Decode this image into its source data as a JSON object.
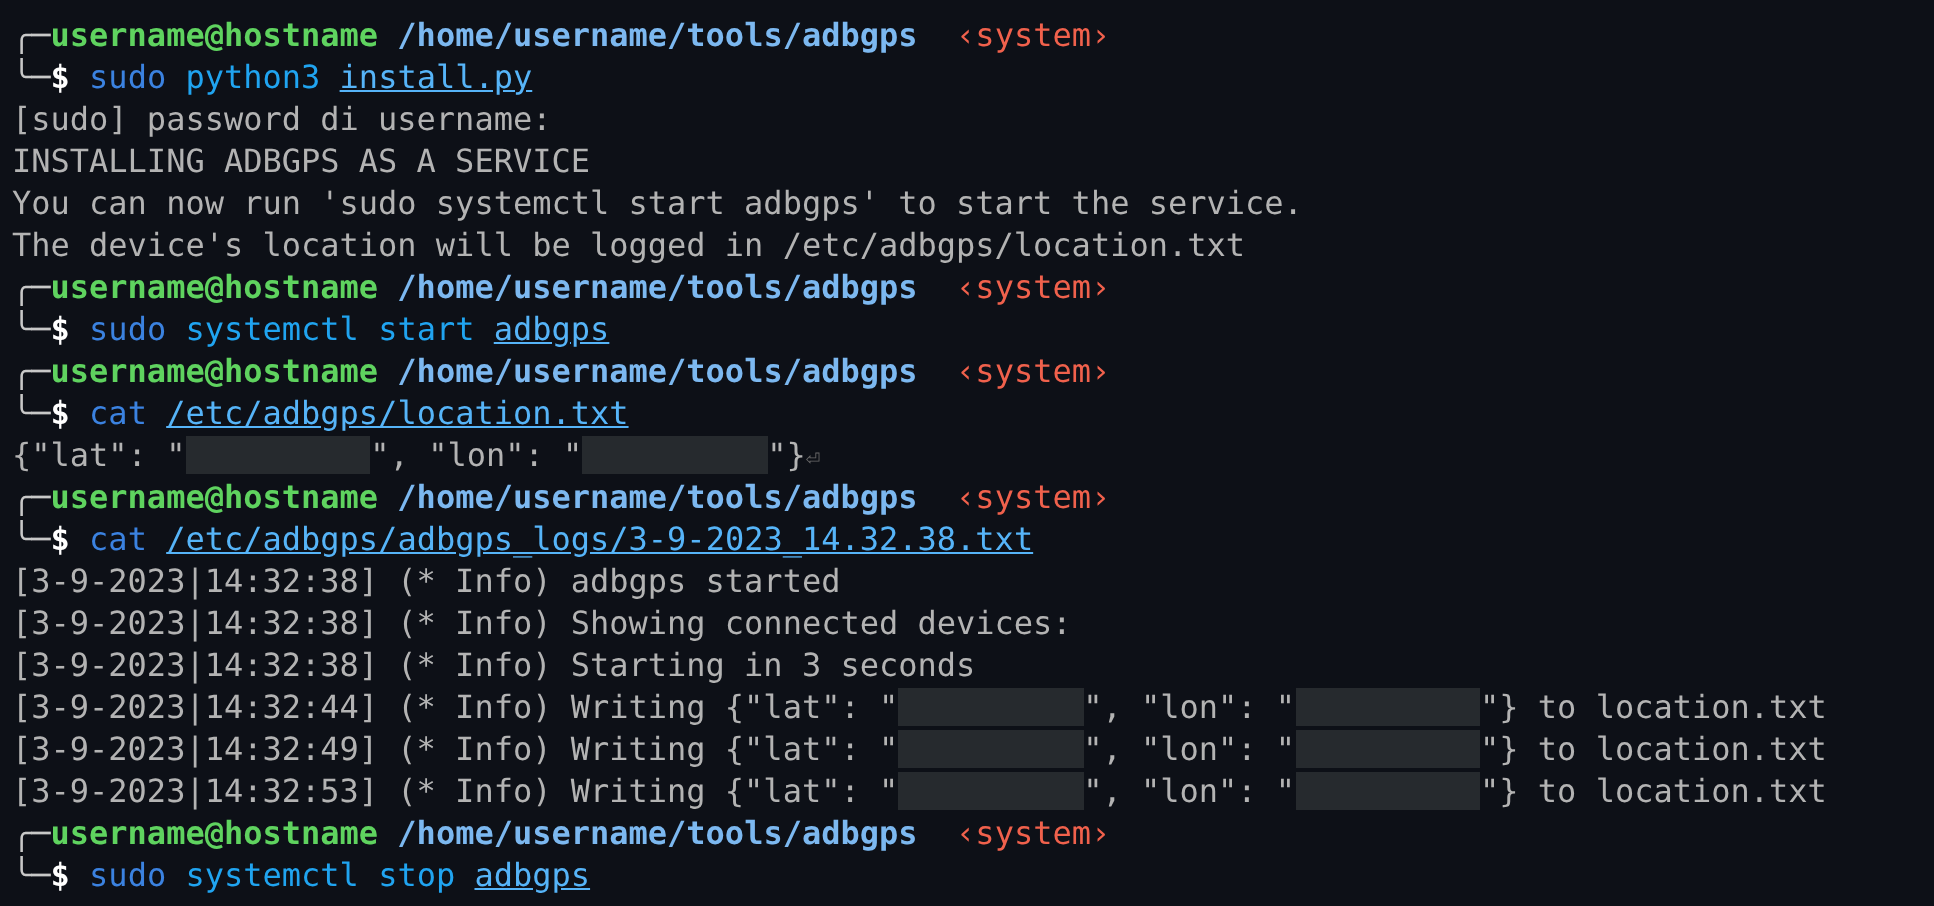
{
  "lines": [
    {
      "kind": "prompt",
      "corner": "╭─",
      "user": "username@hostname",
      "path": "/home/username/tools/adbgps",
      "tag": "‹system›"
    },
    {
      "kind": "command",
      "corner": "╰─",
      "sign": "$",
      "parts": [
        {
          "kind": "program",
          "text": "sudo"
        },
        {
          "kind": "word",
          "text": "python3"
        },
        {
          "kind": "path",
          "text": "install.py"
        }
      ]
    },
    {
      "kind": "output",
      "segments": [
        {
          "kind": "text",
          "text": "[sudo] password di username:"
        }
      ]
    },
    {
      "kind": "output",
      "segments": [
        {
          "kind": "text",
          "text": "INSTALLING ADBGPS AS A SERVICE"
        }
      ]
    },
    {
      "kind": "output",
      "segments": [
        {
          "kind": "text",
          "text": "You can now run 'sudo systemctl start adbgps' to start the service."
        }
      ]
    },
    {
      "kind": "output",
      "segments": [
        {
          "kind": "text",
          "text": "The device's location will be logged in /etc/adbgps/location.txt"
        }
      ]
    },
    {
      "kind": "prompt",
      "corner": "╭─",
      "user": "username@hostname",
      "path": "/home/username/tools/adbgps",
      "tag": "‹system›"
    },
    {
      "kind": "command",
      "corner": "╰─",
      "sign": "$",
      "parts": [
        {
          "kind": "program",
          "text": "sudo"
        },
        {
          "kind": "word",
          "text": "systemctl"
        },
        {
          "kind": "word",
          "text": "start"
        },
        {
          "kind": "path",
          "text": "adbgps"
        }
      ]
    },
    {
      "kind": "prompt",
      "corner": "╭─",
      "user": "username@hostname",
      "path": "/home/username/tools/adbgps",
      "tag": "‹system›"
    },
    {
      "kind": "command",
      "corner": "╰─",
      "sign": "$",
      "parts": [
        {
          "kind": "program",
          "text": "cat"
        },
        {
          "kind": "path",
          "text": "/etc/adbgps/location.txt"
        }
      ]
    },
    {
      "kind": "output",
      "segments": [
        {
          "kind": "text",
          "text": "{\"lat\": \""
        },
        {
          "kind": "redacted"
        },
        {
          "kind": "text",
          "text": "\", \"lon\": \""
        },
        {
          "kind": "redacted"
        },
        {
          "kind": "text",
          "text": "\"}"
        },
        {
          "kind": "eol",
          "text": "⏎"
        }
      ]
    },
    {
      "kind": "prompt",
      "corner": "╭─",
      "user": "username@hostname",
      "path": "/home/username/tools/adbgps",
      "tag": "‹system›"
    },
    {
      "kind": "command",
      "corner": "╰─",
      "sign": "$",
      "parts": [
        {
          "kind": "program",
          "text": "cat"
        },
        {
          "kind": "path",
          "text": "/etc/adbgps/adbgps_logs/3-9-2023_14.32.38.txt"
        }
      ]
    },
    {
      "kind": "output",
      "segments": [
        {
          "kind": "text",
          "text": "[3-9-2023|14:32:38] (* Info) adbgps started"
        }
      ]
    },
    {
      "kind": "output",
      "segments": [
        {
          "kind": "text",
          "text": "[3-9-2023|14:32:38] (* Info) Showing connected devices:"
        }
      ]
    },
    {
      "kind": "output",
      "segments": [
        {
          "kind": "text",
          "text": "[3-9-2023|14:32:38] (* Info) Starting in 3 seconds"
        }
      ]
    },
    {
      "kind": "output",
      "segments": [
        {
          "kind": "text",
          "text": "[3-9-2023|14:32:44] (* Info) Writing {\"lat\": \""
        },
        {
          "kind": "redacted"
        },
        {
          "kind": "text",
          "text": "\", \"lon\": \""
        },
        {
          "kind": "redacted"
        },
        {
          "kind": "text",
          "text": "\"} to location.txt"
        }
      ]
    },
    {
      "kind": "output",
      "segments": [
        {
          "kind": "text",
          "text": "[3-9-2023|14:32:49] (* Info) Writing {\"lat\": \""
        },
        {
          "kind": "redacted"
        },
        {
          "kind": "text",
          "text": "\", \"lon\": \""
        },
        {
          "kind": "redacted"
        },
        {
          "kind": "text",
          "text": "\"} to location.txt"
        }
      ]
    },
    {
      "kind": "output",
      "segments": [
        {
          "kind": "text",
          "text": "[3-9-2023|14:32:53] (* Info) Writing {\"lat\": \""
        },
        {
          "kind": "redacted"
        },
        {
          "kind": "text",
          "text": "\", \"lon\": \""
        },
        {
          "kind": "redacted"
        },
        {
          "kind": "text",
          "text": "\"} to location.txt"
        }
      ]
    },
    {
      "kind": "prompt",
      "corner": "╭─",
      "user": "username@hostname",
      "path": "/home/username/tools/adbgps",
      "tag": "‹system›"
    },
    {
      "kind": "command",
      "corner": "╰─",
      "sign": "$",
      "parts": [
        {
          "kind": "program",
          "text": "sudo"
        },
        {
          "kind": "word",
          "text": "systemctl"
        },
        {
          "kind": "word",
          "text": "stop"
        },
        {
          "kind": "path",
          "text": "adbgps"
        }
      ]
    }
  ]
}
